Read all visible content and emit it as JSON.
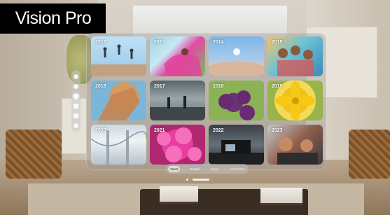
{
  "branding": {
    "apple_glyph": "",
    "product_name": "Vision Pro"
  },
  "photos": {
    "tiles": [
      {
        "year": "2012",
        "icon": "photo-jumping-people"
      },
      {
        "year": "2013",
        "icon": "photo-person-pink-fabric"
      },
      {
        "year": "2014",
        "icon": "photo-desert-sunlight"
      },
      {
        "year": "2015",
        "icon": "photo-group-selfie"
      },
      {
        "year": "2016",
        "icon": "photo-hand-sky"
      },
      {
        "year": "2017",
        "icon": "photo-beach-silhouettes"
      },
      {
        "year": "2018",
        "icon": "photo-purple-vegetables"
      },
      {
        "year": "2019",
        "icon": "photo-yellow-flower"
      },
      {
        "year": "2020",
        "icon": "photo-bridge"
      },
      {
        "year": "2021",
        "icon": "photo-pink-flowers"
      },
      {
        "year": "2022",
        "icon": "photo-cabin"
      },
      {
        "year": "2023",
        "icon": "photo-car-selfie"
      }
    ]
  },
  "tabs": {
    "years": "Years",
    "months": "Months",
    "days": "Days",
    "all_photos": "All Photos"
  },
  "colors": {
    "logo_background": "#000000",
    "panel_glass": "rgba(150,150,150,0.38)"
  }
}
